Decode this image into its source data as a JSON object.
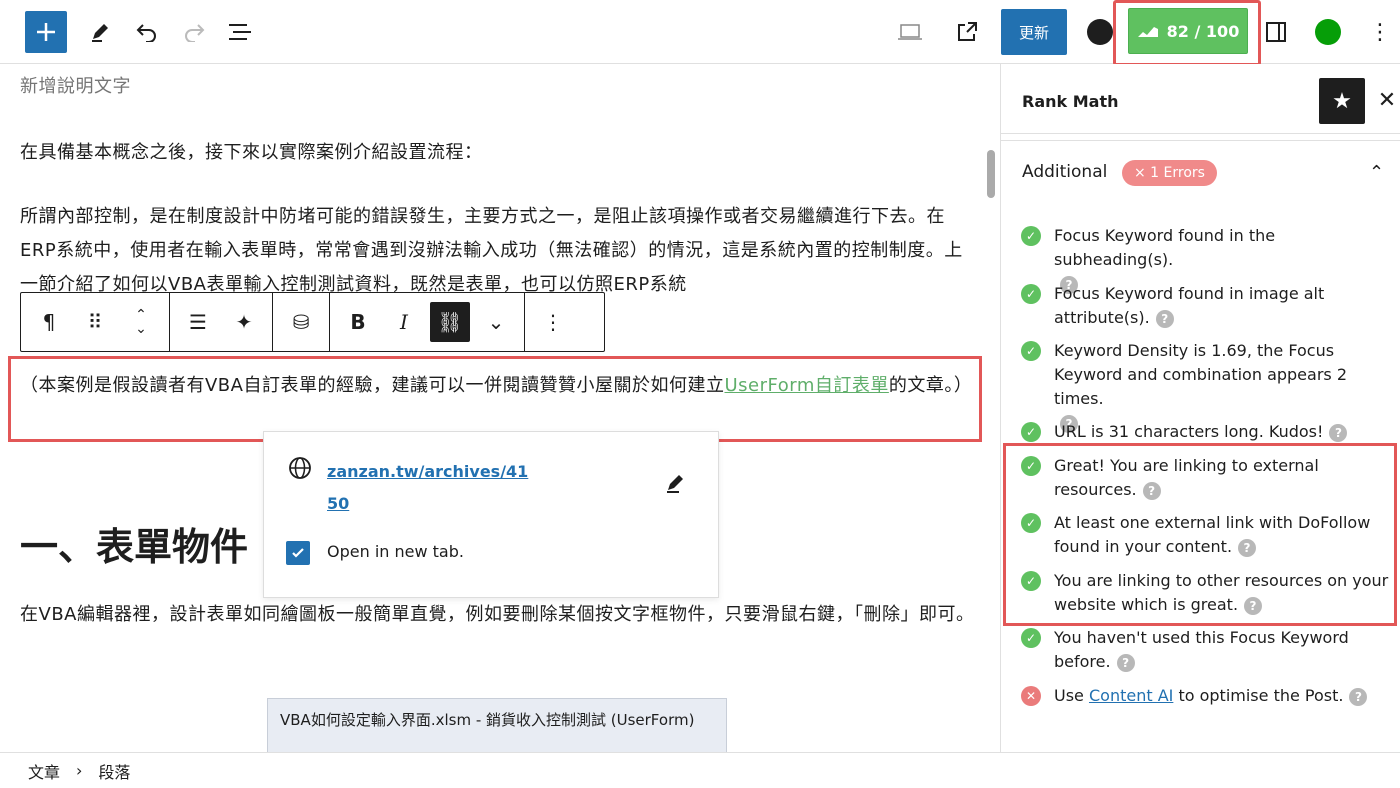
{
  "topbar": {
    "update_label": "更新",
    "score_label": "82 / 100"
  },
  "editor": {
    "caption": "新增說明文字",
    "para1": "在具備基本概念之後，接下來以實際案例介紹設置流程：",
    "para2": "所謂內部控制，是在制度設計中防堵可能的錯誤發生，主要方式之一，是阻止該項操作或者交易繼續進行下去。在ERP系統中，使用者在輸入表單時，常常會遇到沒辦法輸入成功（無法確認）的情況，這是系統內置的控制制度。上一節介紹了如何以VBA表單輸入控制測試資料，既然是表單，也可以仿照ERP系統",
    "para3_pre": "（本案例是假設讀者有VBA自訂表單的經驗，建議可以一併閱讀贊贊小屋關於如何建立",
    "para3_link": "UserForm自訂表單",
    "para3_post": "的文章。）",
    "link_url_line1": "zanzan.tw/archives/41",
    "link_url_line2": "50",
    "open_new_tab": "Open in new tab.",
    "heading": "一、表單物件",
    "para4": "在VBA編輯器裡，設計表單如同繪圖板一般簡單直覺，例如要刪除某個按文字框物件，只要滑鼠右鍵，「刪除」即可。",
    "image_title": "VBA如何設定輸入界面.xlsm - 銷貨收入控制測試 (UserForm)"
  },
  "footer": {
    "crumb1": "文章",
    "crumb2": "段落"
  },
  "sidebar": {
    "title": "Rank Math",
    "section": "Additional",
    "errors_badge": "× 1 Errors",
    "checks": [
      {
        "text": "Focus Keyword found in the subheading(s).",
        "status": "ok"
      },
      {
        "text": "Focus Keyword found in image alt attribute(s).",
        "status": "ok"
      },
      {
        "text": "Keyword Density is 1.69, the Focus Keyword and combination appears 2 times.",
        "status": "ok"
      },
      {
        "text": "URL is 31 characters long. Kudos!",
        "status": "ok"
      },
      {
        "text": "Great! You are linking to external resources.",
        "status": "ok"
      },
      {
        "text": "At least one external link with DoFollow found in your content.",
        "status": "ok"
      },
      {
        "text": "You are linking to other resources on your website which is great.",
        "status": "ok"
      },
      {
        "text": "You haven't used this Focus Keyword before.",
        "status": "ok"
      }
    ],
    "last_pre": "Use ",
    "last_link": "Content AI",
    "last_post": " to optimise the Post."
  },
  "colors": {
    "accent": "#2271b1",
    "score_green": "#5fc160",
    "highlight_red": "#e25757"
  }
}
